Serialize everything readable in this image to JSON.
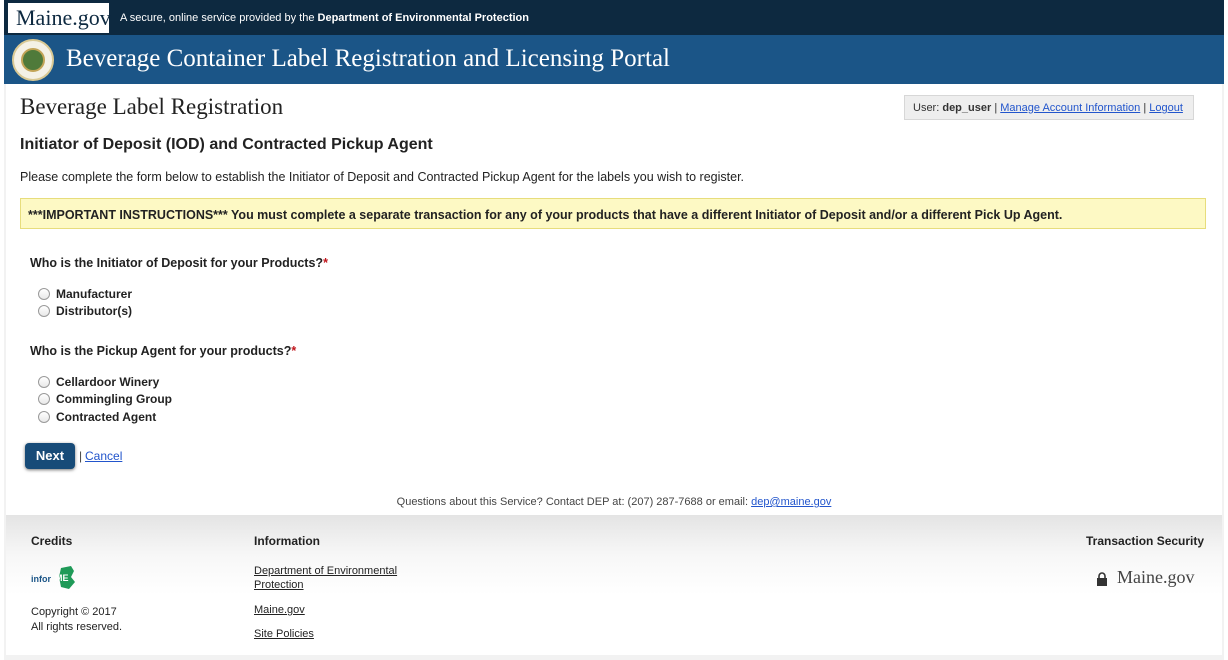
{
  "topbar": {
    "logo": "Maine.gov",
    "tagline_prefix": "A secure, online service provided by the ",
    "tagline_org": "Department of Environmental Protection"
  },
  "banner": {
    "title": "Beverage Container Label Registration and Licensing Portal"
  },
  "page": {
    "title": "Beverage Label Registration",
    "section_title": "Initiator of Deposit (IOD) and Contracted Pickup Agent",
    "intro": "Please complete the form below to establish the Initiator of Deposit and Contracted Pickup Agent for the labels you wish to register.",
    "important": "***IMPORTANT INSTRUCTIONS*** You must complete a separate transaction for any of your products that have a different Initiator of Deposit and/or a different Pick Up Agent."
  },
  "userbox": {
    "prefix": "User: ",
    "username": "dep_user",
    "sep1": " | ",
    "manage": "Manage Account Information",
    "sep2": " | ",
    "logout": "Logout"
  },
  "form": {
    "required_mark": "*",
    "iod": {
      "question": "Who is the Initiator of Deposit for your Products?",
      "options": [
        "Manufacturer",
        "Distributor(s)"
      ]
    },
    "pickup": {
      "question": "Who is the Pickup Agent for your products?",
      "options": [
        "Cellardoor Winery",
        "Commingling Group",
        "Contracted Agent"
      ]
    },
    "next_label": "Next",
    "separator": "|",
    "cancel_label": "Cancel"
  },
  "contact": {
    "text": "Questions about this Service? Contact DEP at: (207) 287-7688 or email: ",
    "email": "dep@maine.gov"
  },
  "footer": {
    "credits_heading": "Credits",
    "copyright": "Copyright © 2017",
    "rights": "All rights reserved.",
    "information_heading": "Information",
    "links": [
      "Department of Environmental Protection",
      "Maine.gov",
      "Site Policies"
    ],
    "security_heading": "Transaction Security",
    "logo_text": "Maine.gov",
    "informe_logo": "InforME"
  },
  "colors": {
    "topbar": "#0d2940",
    "banner": "#1b5587",
    "button": "#174b78",
    "link": "#2255cc",
    "required": "#c0151b",
    "notice_bg": "#fdf9c4"
  },
  "icons": [
    "state-seal-icon",
    "lock-icon",
    "informe-logo-icon"
  ]
}
